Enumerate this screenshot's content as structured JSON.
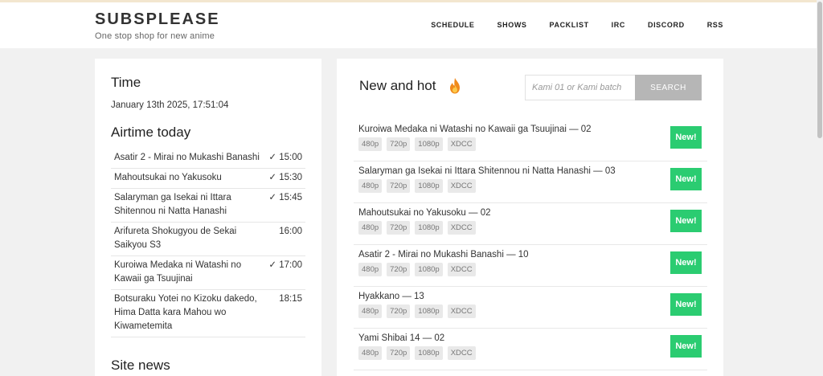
{
  "header": {
    "title": "SUBSPLEASE",
    "tagline": "One stop shop for new anime",
    "nav": [
      "SCHEDULE",
      "SHOWS",
      "PACKLIST",
      "IRC",
      "DISCORD",
      "RSS"
    ]
  },
  "time_section": {
    "heading": "Time",
    "current": "January 13th 2025, 17:51:04"
  },
  "airtime": {
    "heading": "Airtime today",
    "items": [
      {
        "title": "Asatir 2 - Mirai no Mukashi Banashi",
        "time": "✓ 15:00"
      },
      {
        "title": "Mahoutsukai no Yakusoku",
        "time": "✓ 15:30"
      },
      {
        "title": "Salaryman ga Isekai ni Ittara Shitennou ni Natta Hanashi",
        "time": "✓ 15:45"
      },
      {
        "title": "Arifureta Shokugyou de Sekai Saikyou S3",
        "time": "16:00"
      },
      {
        "title": "Kuroiwa Medaka ni Watashi no Kawaii ga Tsuujinai",
        "time": "✓ 17:00"
      },
      {
        "title": "Botsuraku Yotei no Kizoku dakedo, Hima Datta kara Mahou wo Kiwametemita",
        "time": "18:15"
      }
    ]
  },
  "site_news": {
    "heading": "Site news"
  },
  "new_hot": {
    "heading": "New and hot",
    "icon": "fire-icon",
    "search_placeholder": "Kami 01 or Kami batch",
    "search_button": "SEARCH",
    "releases": [
      {
        "title": "Kuroiwa Medaka ni Watashi no Kawaii ga Tsuujinai — 02",
        "badge": "New!"
      },
      {
        "title": "Salaryman ga Isekai ni Ittara Shitennou ni Natta Hanashi — 03",
        "badge": "New!"
      },
      {
        "title": "Mahoutsukai no Yakusoku — 02",
        "badge": "New!"
      },
      {
        "title": "Asatir 2 - Mirai no Mukashi Banashi — 10",
        "badge": "New!"
      },
      {
        "title": "Hyakkano — 13",
        "badge": "New!"
      },
      {
        "title": "Yami Shibai 14 — 02",
        "badge": "New!"
      }
    ],
    "links": [
      "480p",
      "720p",
      "1080p",
      "XDCC"
    ]
  },
  "colors": {
    "badge_green": "#2bcc71",
    "search_button_bg": "#b6b6b6",
    "page_bg": "#f1f1f1"
  }
}
